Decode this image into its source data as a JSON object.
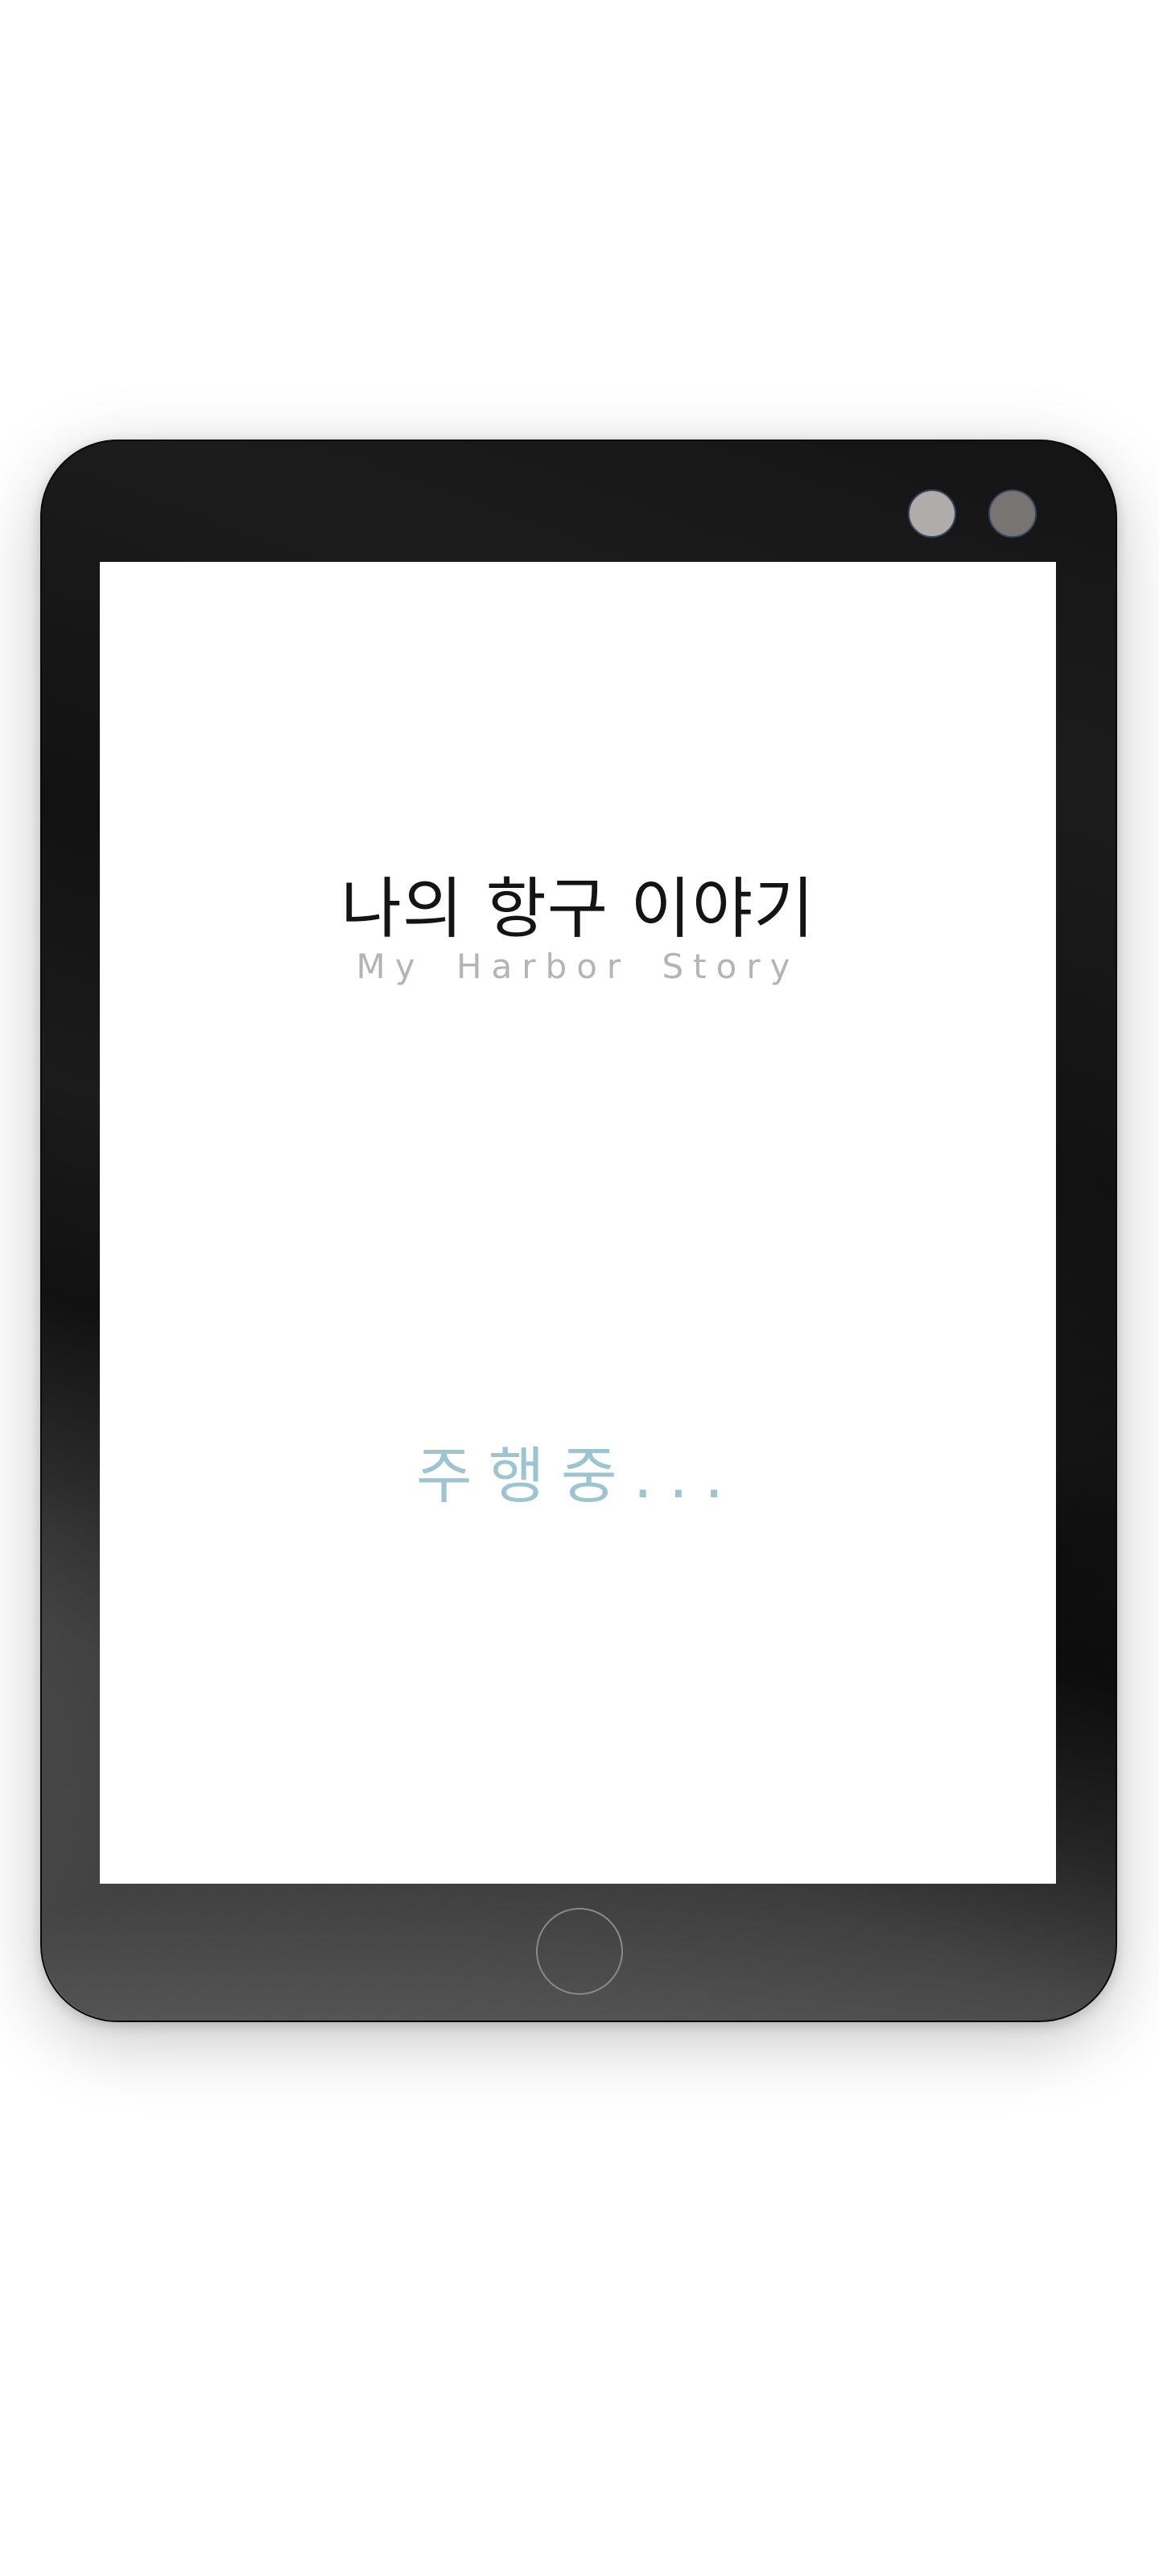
{
  "device": {
    "camera_left_color": "#b0acaa",
    "camera_right_color": "#787472",
    "home_button_icon": "home-button-circle"
  },
  "screen": {
    "title": "나의 항구 이야기",
    "subtitle": "My Harbor Story",
    "status": "주행중..."
  },
  "colors": {
    "bezel": "#141414",
    "screen_background": "#ffffff",
    "title": "#141414",
    "subtitle": "#b4b4b4",
    "status": "#9ec4cf"
  }
}
